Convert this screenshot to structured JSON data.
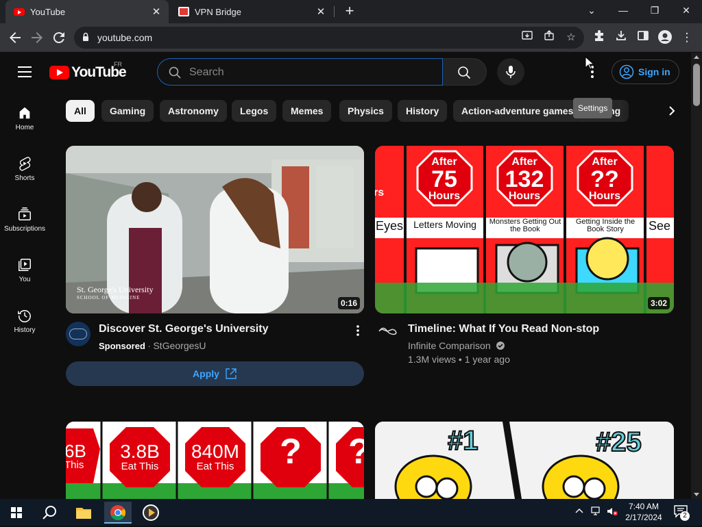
{
  "browser": {
    "tabs": [
      {
        "title": "YouTube",
        "active": true
      },
      {
        "title": "VPN Bridge",
        "active": false
      }
    ],
    "address": "youtube.com"
  },
  "masthead": {
    "logo_text": "YouTube",
    "country_code": "FR",
    "search_placeholder": "Search",
    "signin_label": "Sign in"
  },
  "sidebar": {
    "items": [
      {
        "label": "Home",
        "icon": "home-icon"
      },
      {
        "label": "Shorts",
        "icon": "shorts-icon"
      },
      {
        "label": "Subscriptions",
        "icon": "subscriptions-icon"
      },
      {
        "label": "You",
        "icon": "you-icon"
      },
      {
        "label": "History",
        "icon": "history-icon"
      }
    ]
  },
  "chips": [
    "All",
    "Gaming",
    "Astronomy",
    "Legos",
    "Memes",
    "Physics",
    "History",
    "Action-adventure games",
    "Painting"
  ],
  "tooltip": "Settings",
  "videos": [
    {
      "title": "Discover St. George's University",
      "sponsored": "Sponsored",
      "separator": " · ",
      "channel": "StGeorgesU",
      "duration": "0:16",
      "watermark": "St. George's University",
      "watermark_sub": "SCHOOL OF MEDICINE",
      "cta_label": "Apply"
    },
    {
      "title": "Timeline: What If You Read Non-stop",
      "channel": "Infinite Comparison",
      "stats": "1.3M views • 1 year ago",
      "duration": "3:02",
      "panels": [
        {
          "top": "After",
          "num": "75",
          "bottom": "Hours",
          "caption": "Letters Moving"
        },
        {
          "top": "After",
          "num": "132",
          "bottom": "Hours",
          "caption": "Monsters Getting Out the Book"
        },
        {
          "top": "After",
          "num": "??",
          "bottom": "Hours",
          "caption": "Getting Inside the Book Story"
        }
      ],
      "partial_caption_left": "Eyes",
      "partial_caption_right": "See",
      "partial_text_left": "rs"
    },
    {
      "labels": [
        {
          "num": "3.8B",
          "sub": "Eat This"
        },
        {
          "num": "840M",
          "sub": "Eat This"
        },
        {
          "num": "?",
          "sub": ""
        }
      ],
      "partial_left_num": "6B",
      "partial_left_sub": "This"
    },
    {
      "left_badge": "#1",
      "right_badge": "#25"
    }
  ],
  "taskbar": {
    "time": "7:40 AM",
    "date": "2/17/2024",
    "notifications": "2"
  }
}
